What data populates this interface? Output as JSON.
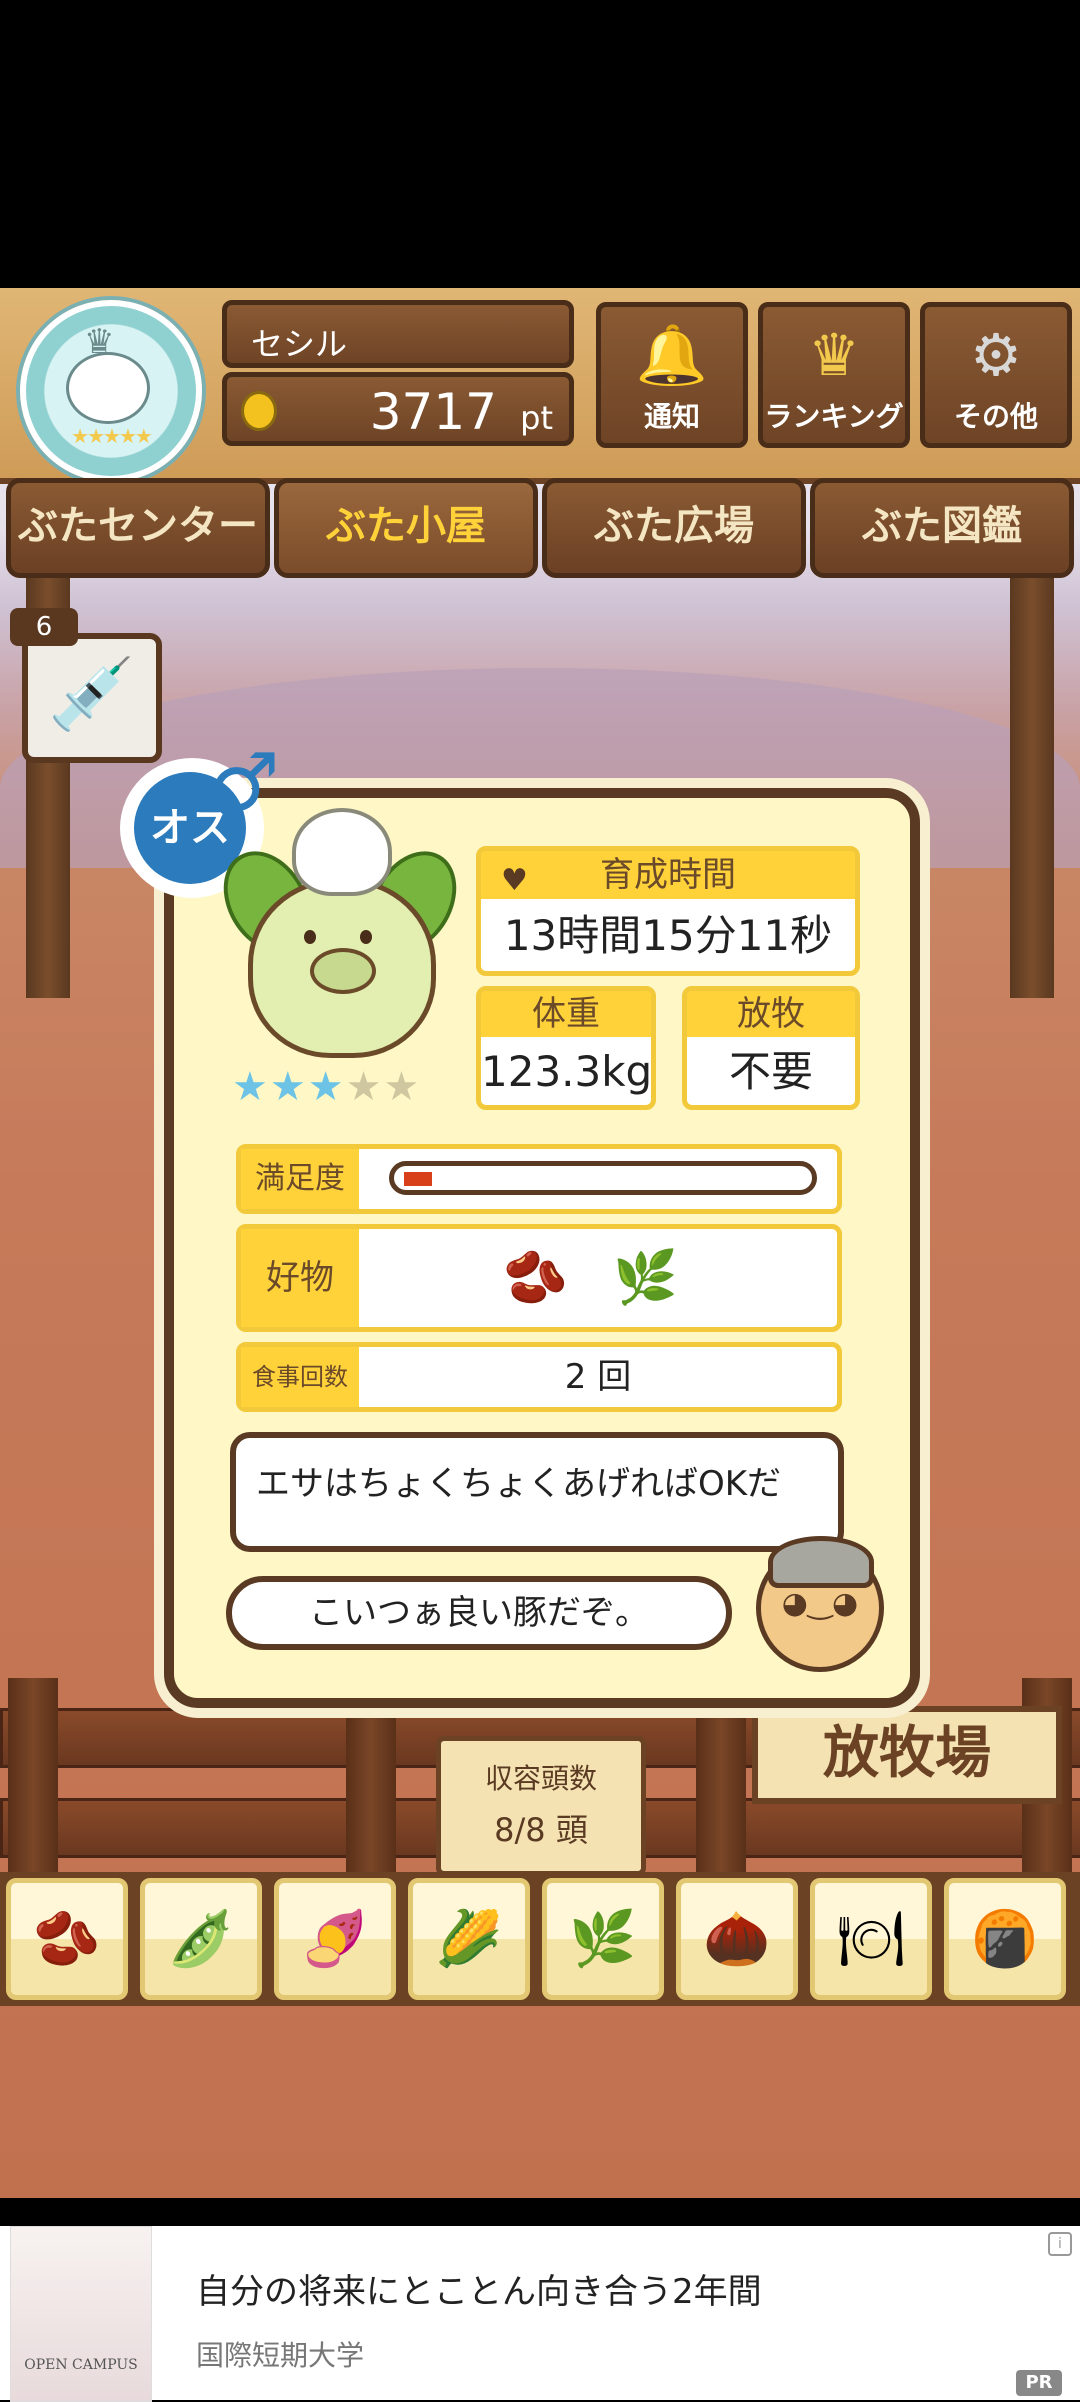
{
  "header": {
    "player_name": "セシル",
    "points_value": "3717",
    "points_unit": "pt",
    "buttons": [
      {
        "label": "通知",
        "icon": "bell-icon"
      },
      {
        "label": "ランキング",
        "icon": "crown-icon"
      },
      {
        "label": "その他",
        "icon": "gear-icon"
      }
    ]
  },
  "tabs": [
    {
      "label": "ぶたセンター",
      "active": false
    },
    {
      "label": "ぶた小屋",
      "active": true
    },
    {
      "label": "ぶた広場",
      "active": false
    },
    {
      "label": "ぶた図鑑",
      "active": false
    }
  ],
  "item_badge": {
    "count": "6",
    "icon": "syringe-icon"
  },
  "pig": {
    "gender_label": "オス",
    "rating": {
      "filled": 3,
      "total": 5
    },
    "stats": {
      "time_label": "育成時間",
      "time_value": "13時間15分11秒",
      "weight_label": "体重",
      "weight_value": "123.3kg",
      "graze_label": "放牧",
      "graze_value": "不要"
    },
    "satisfaction_label": "満足度",
    "satisfaction_level": 0.07,
    "favorite_label": "好物",
    "favorite_foods": [
      "soybean-pile-icon",
      "leafy-beans-icon"
    ],
    "meals_label": "食事回数",
    "meals_value": "2 回",
    "hint": "エサはちょくちょくあげればOKだ",
    "comment": "こいつぁ良い豚だぞ。"
  },
  "capacity": {
    "label": "収容頭数",
    "value": "8/8 頭"
  },
  "pasture_sign": "放牧場",
  "food_tray": [
    "soybean-pile-icon",
    "mixed-bean-pile-icon",
    "sweet-potato-icon",
    "corn-icon",
    "leafy-beans-icon",
    "acorn-icon",
    "bean-plate-icon",
    "meatball-plate-icon"
  ],
  "ad": {
    "title": "自分の将来にとことん向き合う2年間",
    "subtitle": "国際短期大学",
    "image_caption": "OPEN CAMPUS",
    "pr_label": "PR",
    "info_label": "i"
  },
  "colors": {
    "accent": "#ffd23a",
    "wood": "#6b4224",
    "gender_blue": "#2b7bbd",
    "star": "#6cc3e6"
  }
}
